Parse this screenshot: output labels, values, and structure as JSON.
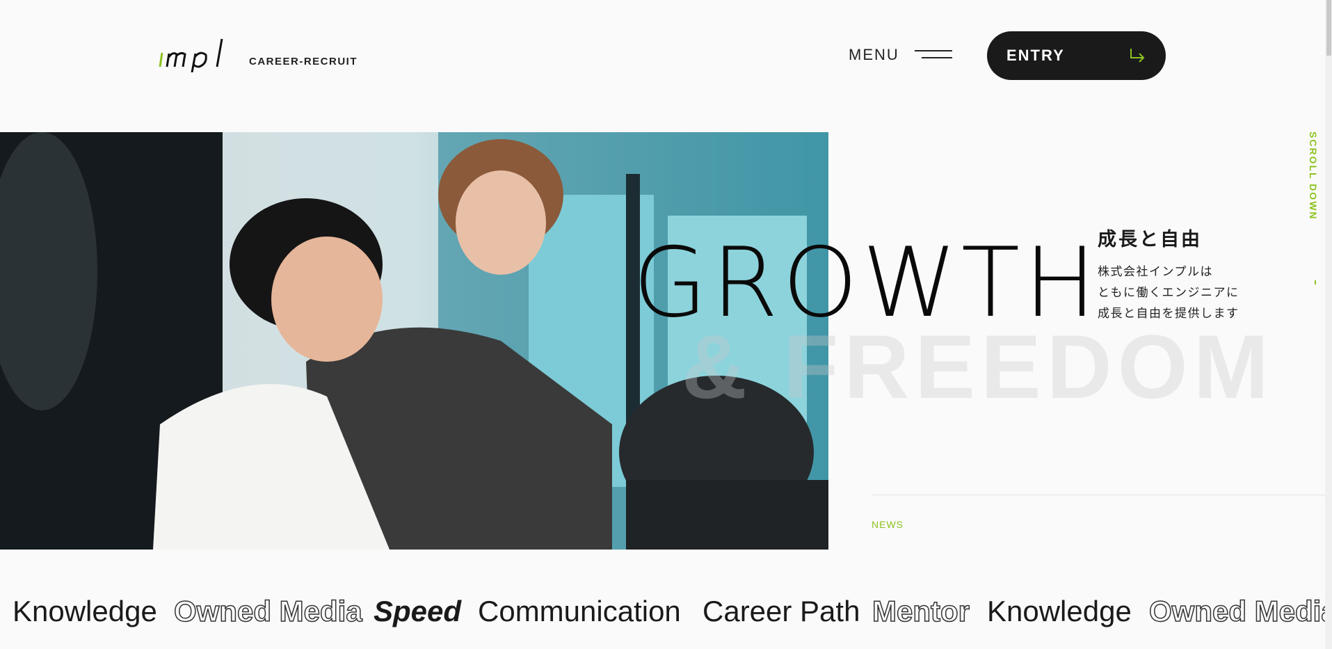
{
  "header": {
    "logo_text": "impl",
    "tagline": "CAREER-RECRUIT",
    "menu_label": "MENU",
    "entry_label": "ENTRY"
  },
  "hero": {
    "headline": "GROWTH",
    "subheadline": "& FREEDOM",
    "title_jp": "成長と自由",
    "lines_jp": [
      "株式会社インプルは",
      "ともに働くエンジニアに",
      "成長と自由を提供します"
    ],
    "scroll_label": "SCROLL DOWN"
  },
  "news": {
    "label": "NEWS"
  },
  "marquee": [
    {
      "text": "Knowledge",
      "style": "regular"
    },
    {
      "text": "Owned Media",
      "style": "outline"
    },
    {
      "text": "Speed",
      "style": "italic"
    },
    {
      "text": "Communication",
      "style": "regular"
    },
    {
      "text": "Career Path",
      "style": "regular"
    },
    {
      "text": "Mentor",
      "style": "outline"
    },
    {
      "text": "Knowledge",
      "style": "regular"
    },
    {
      "text": "Owned Media",
      "style": "outline"
    }
  ],
  "colors": {
    "accent": "#8cc21f",
    "dark": "#1a1a1a",
    "background": "#fafafa"
  }
}
